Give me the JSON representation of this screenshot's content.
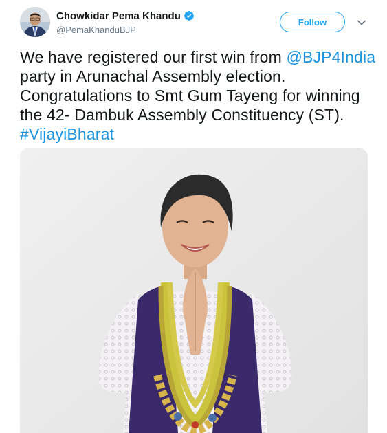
{
  "author": {
    "display_name": "Chowkidar Pema Khandu",
    "handle": "@PemaKhanduBJP",
    "verified": true
  },
  "actions": {
    "follow_label": "Follow",
    "menu_icon": "chevron-down-icon"
  },
  "tweet": {
    "text_1": "We have registered our first win from ",
    "mention": "@BJP4India",
    "text_2": " party in Arunachal Assembly election. Congratulations to Smt Gum Tayeng for winning the 42- Dambuk Assembly Constituency (ST). ",
    "hashtag": "#VijayiBharat"
  },
  "colors": {
    "accent": "#1da1f2",
    "link": "#1b95e0",
    "text": "#14171a",
    "secondary_text": "#657786"
  }
}
